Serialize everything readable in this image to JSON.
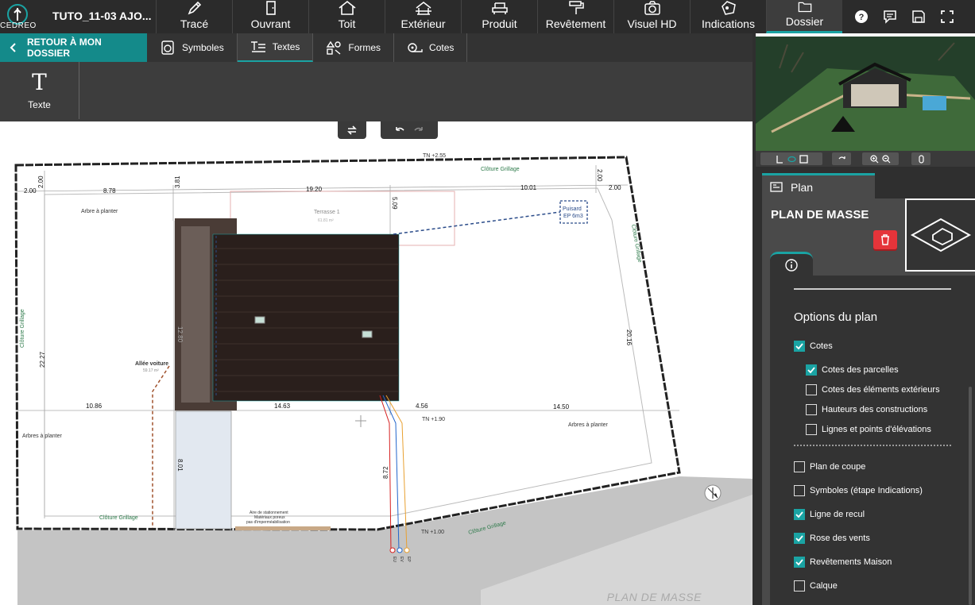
{
  "brand": {
    "logo_text": "CEDREO",
    "project": "TUTO_11-03 AJO..."
  },
  "topnav": [
    {
      "label": "Tracé",
      "icon": "pencil-icon"
    },
    {
      "label": "Ouvrant",
      "icon": "door-icon"
    },
    {
      "label": "Toit",
      "icon": "roof-icon"
    },
    {
      "label": "Extérieur",
      "icon": "exterior-icon"
    },
    {
      "label": "Produit",
      "icon": "furniture-icon"
    },
    {
      "label": "Revêtement",
      "icon": "paint-roller-icon"
    },
    {
      "label": "Visuel HD",
      "icon": "camera-icon"
    },
    {
      "label": "Indications",
      "icon": "shapes-icon"
    },
    {
      "label": "Dossier",
      "icon": "folder-icon",
      "active": true
    }
  ],
  "top_icons": [
    "help-icon",
    "chat-icon",
    "save-icon",
    "fullscreen-icon"
  ],
  "subbar": {
    "back_label": "RETOUR À MON DOSSIER",
    "tabs": [
      {
        "label": "Symboles",
        "icon": "washer-icon"
      },
      {
        "label": "Textes",
        "icon": "text-lines-icon",
        "active": true
      },
      {
        "label": "Formes",
        "icon": "shapes-icon"
      },
      {
        "label": "Cotes",
        "icon": "measure-tape-icon"
      }
    ]
  },
  "tools": {
    "texte_glyph": "T",
    "texte_label": "Texte"
  },
  "plan": {
    "caption": "PLAN DE MASSE",
    "labels": {
      "tn_top": "TN +2.55",
      "cloture_top": "Clôture Grillage",
      "cloture_left": "Clôture Grillage",
      "cloture_right": "Clôture Grillage",
      "cloture_bottom": "Clôture Grillage",
      "cloture_bottom_right": "Clôture Grillage",
      "arbre_top_left": "Arbre à planter",
      "arbres_left": "Arbres à planter",
      "arbres_right": "Arbres à planter",
      "terrasse": "Terrasse 1",
      "terrasse_area": "61.81 m²",
      "puisard_1": "Puisard",
      "puisard_2": "EP 6m3",
      "allee": "Allée voiture",
      "allee_area": "59.17 m²",
      "tn_mid": "TN +1.90",
      "tn_bottom": "TN +1.00",
      "parking_1": "Aire de stationnement",
      "parking_2": "Matériaux poreux",
      "parking_3": "pas d'imperméabilisation",
      "net_1": "EU",
      "net_2": "EV",
      "net_3": "EP"
    },
    "dims": {
      "d_200_a": "2.00",
      "d_200_b": "2.00",
      "d_200_c": "2.00",
      "d_200_d": "2.00",
      "d_878": "8.78",
      "d_381": "3.81",
      "d_1920": "19.20",
      "d_509": "5.09",
      "d_1001": "10.01",
      "d_2227": "22.27",
      "d_2016": "20.16",
      "d_1086": "10.86",
      "d_1463": "14.63",
      "d_456": "4.56",
      "d_1450": "14.50",
      "d_801": "8.01",
      "d_872": "8.72",
      "d_1280": "12.80"
    }
  },
  "panel": {
    "tab_label": "Plan",
    "title": "PLAN DE MASSE",
    "options_heading": "Options du plan",
    "options": [
      {
        "label": "Cotes",
        "checked": true
      },
      {
        "label": "Cotes des parcelles",
        "checked": true
      },
      {
        "label": "Cotes des éléments extérieurs",
        "checked": false
      },
      {
        "label": "Hauteurs des constructions",
        "checked": false
      },
      {
        "label": "Lignes et points d'élévations",
        "checked": false
      },
      {
        "label": "Plan de coupe",
        "checked": false
      },
      {
        "label": "Symboles (étape Indications)",
        "checked": false
      },
      {
        "label": "Ligne de recul",
        "checked": true
      },
      {
        "label": "Rose des vents",
        "checked": true
      },
      {
        "label": "Revêtements Maison",
        "checked": true
      },
      {
        "label": "Calque",
        "checked": false
      }
    ]
  },
  "colors": {
    "accent": "#1aa3a3",
    "danger": "#e5343a",
    "roof": "#2a1f1c"
  }
}
